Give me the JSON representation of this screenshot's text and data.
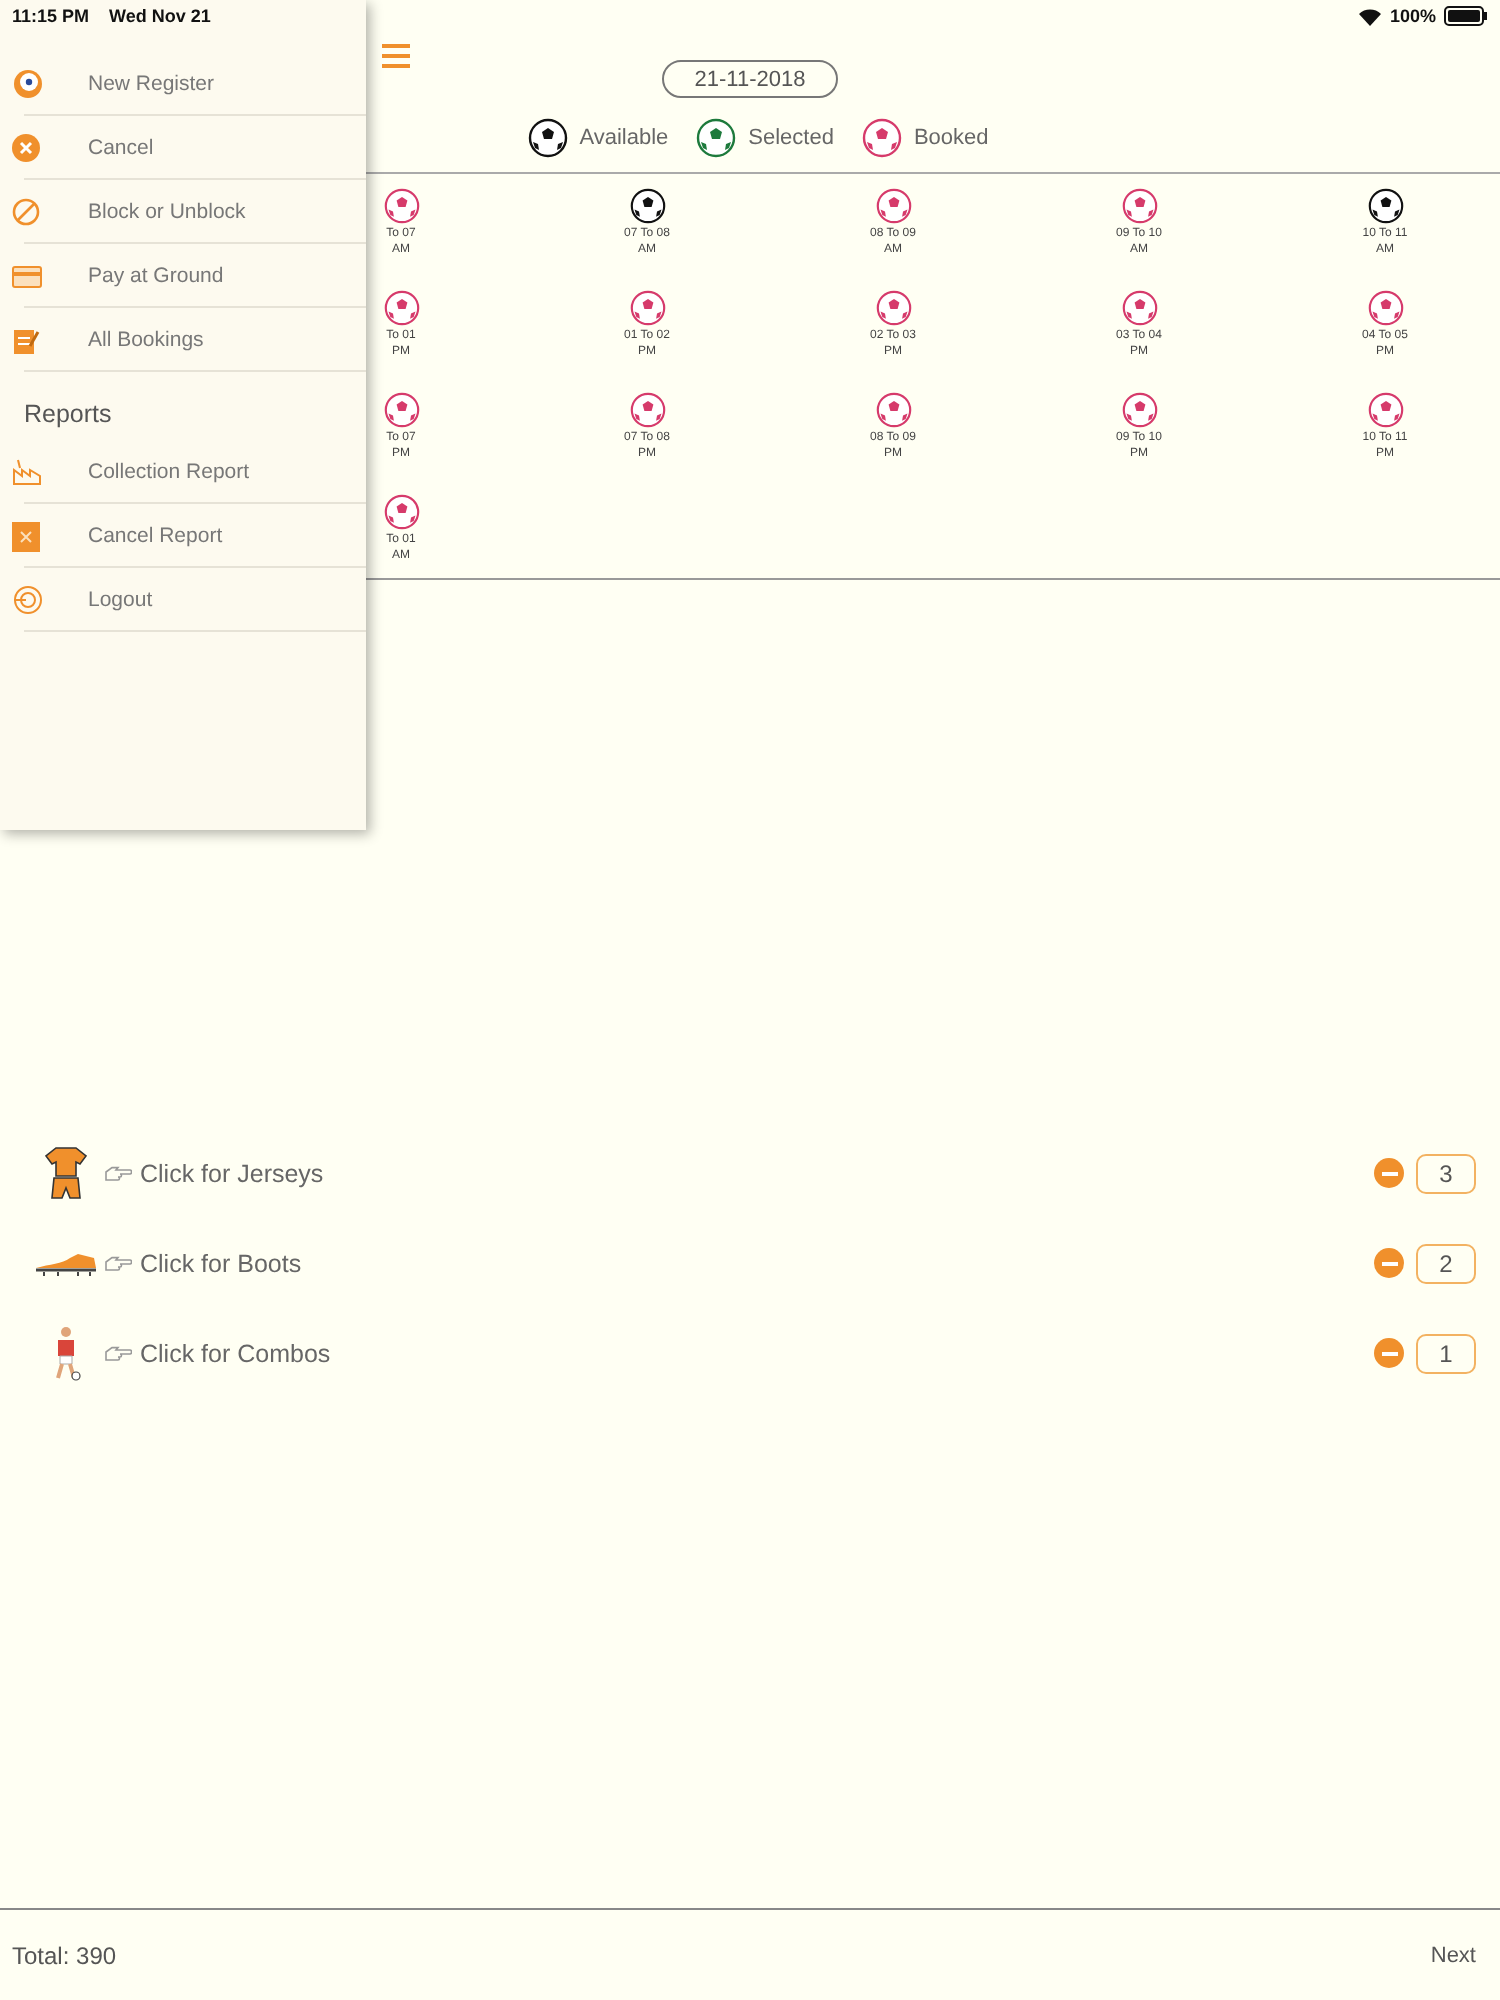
{
  "status_bar": {
    "time": "11:15 PM",
    "date": "Wed Nov 21",
    "battery": "100%"
  },
  "date": "21-11-2018",
  "legend": [
    {
      "label": "Available",
      "kind": "available"
    },
    {
      "label": "Selected",
      "kind": "selected"
    },
    {
      "label": "Booked",
      "kind": "booked"
    }
  ],
  "slots": [
    [
      {
        "time": "To 07",
        "period": "AM",
        "kind": "booked"
      },
      {
        "time": "07 To 08",
        "period": "AM",
        "kind": "available"
      },
      {
        "time": "08 To 09",
        "period": "AM",
        "kind": "booked"
      },
      {
        "time": "09 To 10",
        "period": "AM",
        "kind": "booked"
      },
      {
        "time": "10 To 11",
        "period": "AM",
        "kind": "available"
      }
    ],
    [
      {
        "time": "To 01",
        "period": "PM",
        "kind": "booked"
      },
      {
        "time": "01 To 02",
        "period": "PM",
        "kind": "booked"
      },
      {
        "time": "02 To 03",
        "period": "PM",
        "kind": "booked"
      },
      {
        "time": "03 To 04",
        "period": "PM",
        "kind": "booked"
      },
      {
        "time": "04 To 05",
        "period": "PM",
        "kind": "booked"
      }
    ],
    [
      {
        "time": "To 07",
        "period": "PM",
        "kind": "booked"
      },
      {
        "time": "07 To 08",
        "period": "PM",
        "kind": "booked"
      },
      {
        "time": "08 To 09",
        "period": "PM",
        "kind": "booked"
      },
      {
        "time": "09 To 10",
        "period": "PM",
        "kind": "booked"
      },
      {
        "time": "10 To 11",
        "period": "PM",
        "kind": "booked"
      }
    ],
    [
      {
        "time": "To 01",
        "period": "AM",
        "kind": "booked"
      }
    ]
  ],
  "products": [
    {
      "label": "Click for Jerseys",
      "quantity": "3"
    },
    {
      "label": "Click for Boots",
      "quantity": "2"
    },
    {
      "label": "Click for Combos",
      "quantity": "1"
    }
  ],
  "footer": {
    "total": "Total: 390",
    "next": "Next"
  },
  "drawer": {
    "sections": [
      {
        "items": [
          "New Register",
          "Cancel",
          "Block or Unblock",
          "Pay at Ground",
          "All Bookings"
        ]
      },
      {
        "title": "Reports",
        "items": [
          "Collection Report",
          "Cancel Report",
          "Logout"
        ]
      }
    ]
  }
}
